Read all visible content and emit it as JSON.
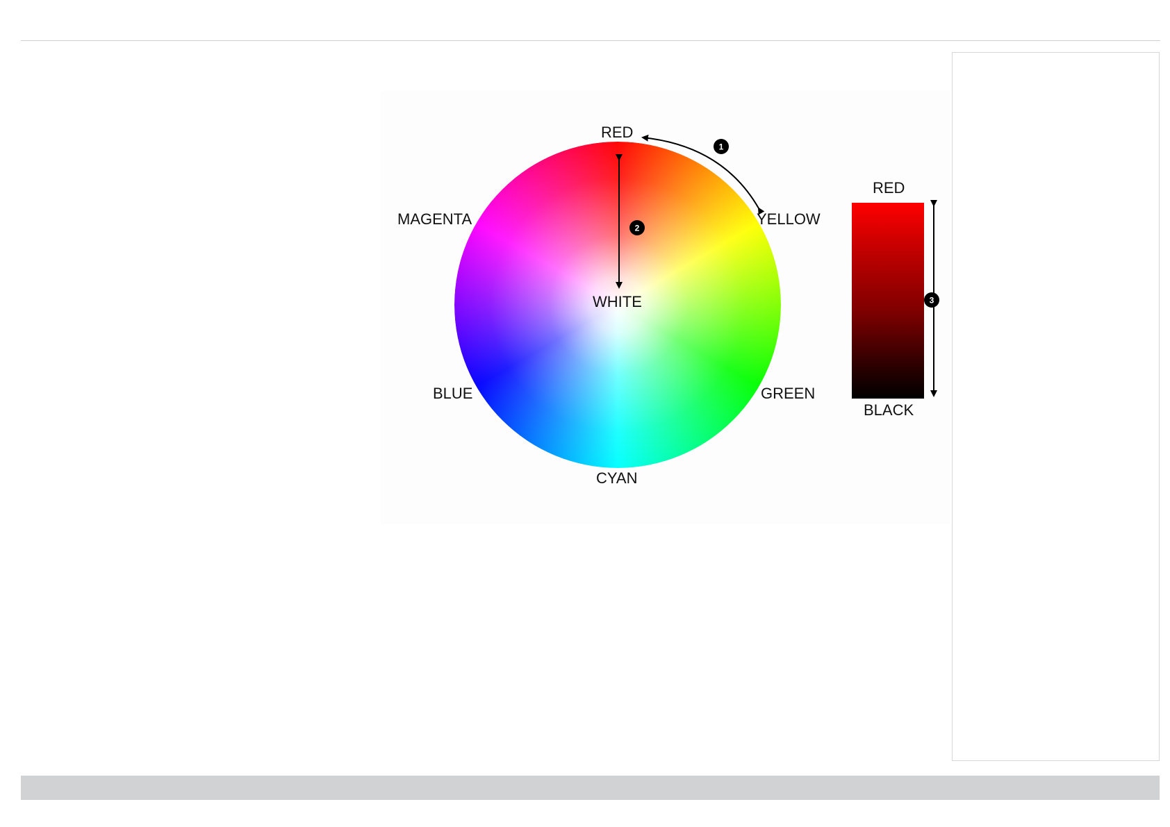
{
  "color_wheel": {
    "labels": {
      "top": "RED",
      "top_right": "YELLOW",
      "right_bottom": "GREEN",
      "bottom": "CYAN",
      "left_bottom": "BLUE",
      "left_top": "MAGENTA",
      "center": "WHITE"
    },
    "callouts": [
      "1",
      "2",
      "3"
    ]
  },
  "intensity_ramp": {
    "top_label": "RED",
    "bottom_label": "BLACK"
  },
  "colors": {
    "red": "#ff0000",
    "yellow": "#ffff00",
    "green": "#00ff00",
    "cyan": "#00ffff",
    "blue": "#0000ff",
    "magenta": "#ff00ff",
    "white": "#ffffff",
    "black": "#000000",
    "footer_bar": "#d1d2d4"
  }
}
